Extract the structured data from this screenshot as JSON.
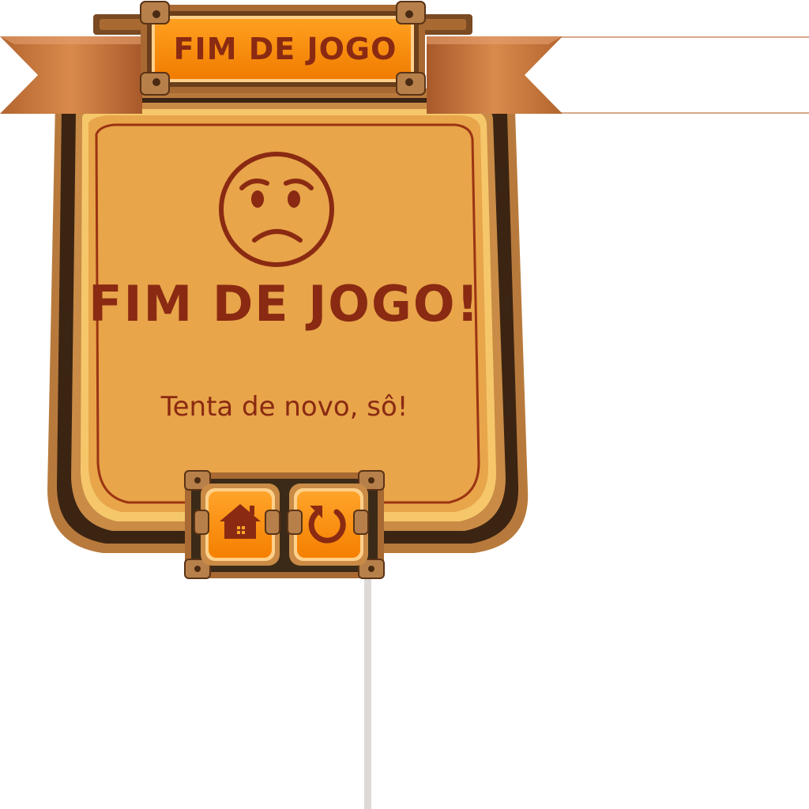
{
  "banner": {
    "title": "FIM DE JOGO"
  },
  "dialog": {
    "face_icon": "sad-face-icon",
    "title": "FIM DE JOGO!",
    "message": "Tenta de novo, sô!"
  },
  "buttons": {
    "home_icon": "home-icon",
    "restart_icon": "restart-icon"
  },
  "colors": {
    "panel_fill": "#e8a54a",
    "panel_rim": "#b87a3c",
    "panel_dark": "#3b2412",
    "text_red": "#8a2a12",
    "ribbon": "#c8763e",
    "button_orange": "#ff8c0a",
    "button_frame": "#3b2a17"
  }
}
